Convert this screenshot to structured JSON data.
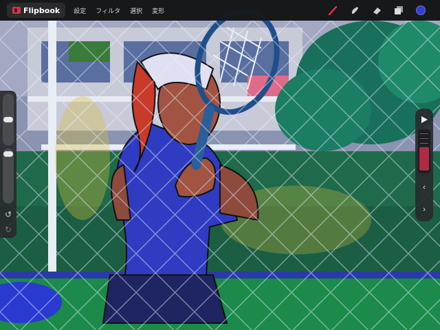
{
  "app": {
    "name": "Flipbook"
  },
  "menu": [
    {
      "label": "設定"
    },
    {
      "label": "フィルタ"
    },
    {
      "label": "選択"
    },
    {
      "label": "変形"
    }
  ],
  "tools": {
    "items": [
      {
        "name": "brush-icon",
        "color": "#e0304a",
        "active": true
      },
      {
        "name": "smudge-icon",
        "color": "#cfcfcf",
        "active": false
      },
      {
        "name": "eraser-icon",
        "color": "#cfcfcf",
        "active": false
      },
      {
        "name": "layers-icon",
        "color": "#cfcfcf",
        "active": false
      }
    ],
    "current_color": "#3340c8"
  },
  "sidebar": {
    "brush_size": 0.93,
    "opacity": 0.88,
    "undo_icon": "↺",
    "redo_icon": "↻"
  },
  "timeline": {
    "play_icon": "play-icon",
    "prev_icon": "‹",
    "next_icon": "›",
    "accent": "#b02a45"
  }
}
